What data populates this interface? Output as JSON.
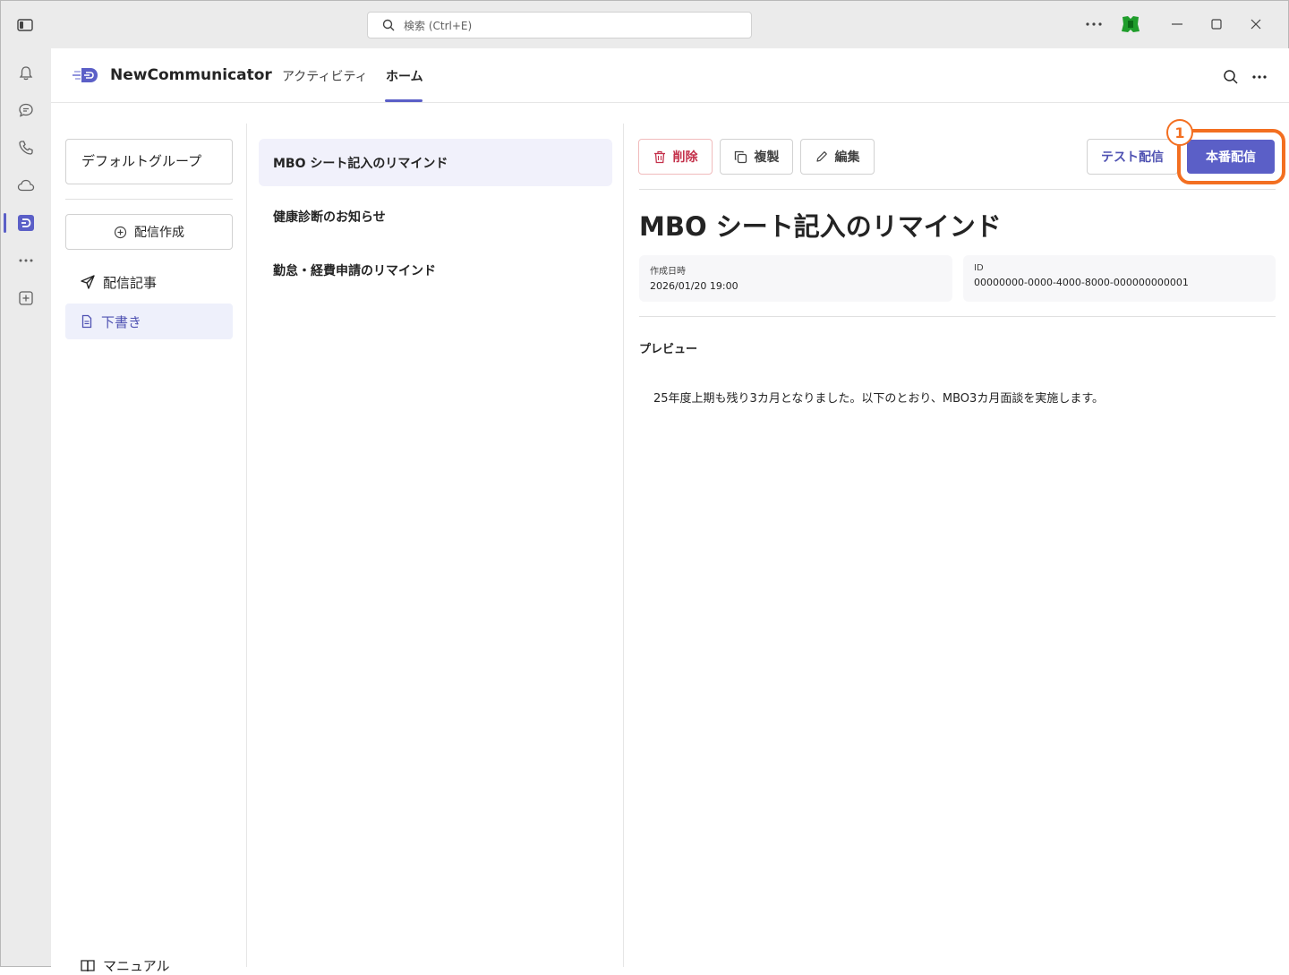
{
  "titlebar": {
    "search_placeholder": "検索 (Ctrl+E)"
  },
  "app": {
    "name": "NewCommunicator",
    "tabs": [
      {
        "label": "アクティビティ",
        "active": false
      },
      {
        "label": "ホーム",
        "active": true
      }
    ]
  },
  "sidebar": {
    "group_label": "デフォルトグループ",
    "create_label": "配信作成",
    "items": [
      {
        "label": "配信記事",
        "icon": "send-icon",
        "active": false
      },
      {
        "label": "下書き",
        "icon": "document-icon",
        "active": true
      }
    ],
    "manual_label": "マニュアル"
  },
  "list": {
    "items": [
      {
        "title": "MBO シート記入のリマインド",
        "selected": true
      },
      {
        "title": "健康診断のお知らせ",
        "selected": false
      },
      {
        "title": "勤怠・経費申請のリマインド",
        "selected": false
      }
    ]
  },
  "detail": {
    "toolbar": {
      "delete_label": "削除",
      "copy_label": "複製",
      "edit_label": "編集",
      "test_label": "テスト配信",
      "publish_label": "本番配信"
    },
    "step_badge": "1",
    "title": "MBO シート記入のリマインド",
    "meta": [
      {
        "label": "作成日時",
        "value": "2026/01/20 19:00"
      },
      {
        "label": "ID",
        "value": "00000000-0000-4000-8000-000000000001"
      }
    ],
    "preview_label": "プレビュー",
    "preview_body": "25年度上期も残り3カ月となりました。以下のとおり、MBO3カ月面談を実施します。"
  },
  "colors": {
    "accent": "#5b5fc7",
    "highlight": "#f36f21",
    "danger": "#c4314b"
  }
}
